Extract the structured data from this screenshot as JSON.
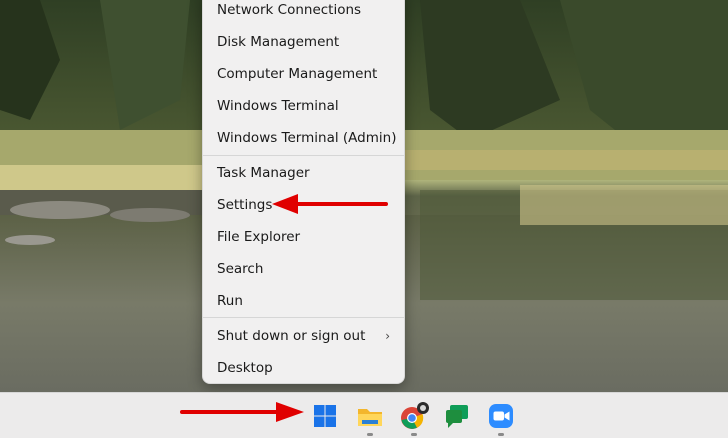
{
  "context_menu": {
    "items": [
      {
        "label": "Network Connections"
      },
      {
        "label": "Disk Management"
      },
      {
        "label": "Computer Management"
      },
      {
        "label": "Windows Terminal"
      },
      {
        "label": "Windows Terminal (Admin)"
      },
      {
        "label": "Task Manager"
      },
      {
        "label": "Settings"
      },
      {
        "label": "File Explorer"
      },
      {
        "label": "Search"
      },
      {
        "label": "Run"
      },
      {
        "label": "Shut down or sign out",
        "submenu": true
      },
      {
        "label": "Desktop"
      }
    ]
  },
  "taskbar": {
    "apps": [
      "start-icon",
      "file-explorer-icon",
      "chrome-icon",
      "chat-icon",
      "zoom-icon"
    ]
  },
  "annotation_color": "#e00000"
}
